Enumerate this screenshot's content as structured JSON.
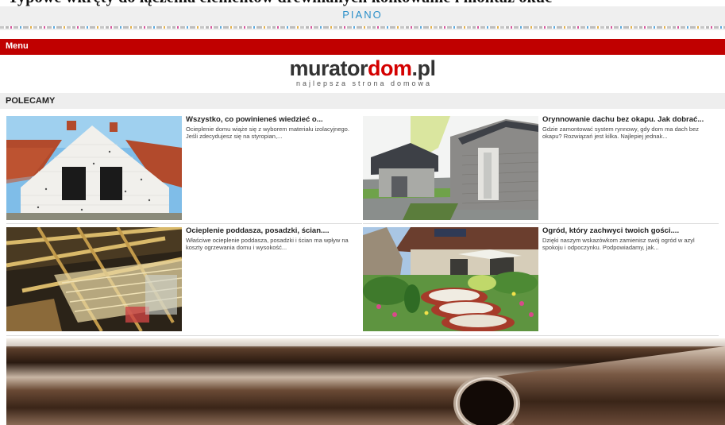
{
  "top_cut_text": "Typowe wkręty do łączenia elementów drewnianych kołkowanie i montaż okuć",
  "piano": {
    "label": "PIANO"
  },
  "menu": {
    "label": "Menu"
  },
  "logo": {
    "part1": "murator",
    "part2": "dom",
    "part3": ".pl",
    "tagline": "najlepsza strona domowa"
  },
  "section": {
    "title": "POLECAMY"
  },
  "cards": [
    {
      "title": "Wszystko, co powinieneś wiedzieć o...",
      "description": "Ocieplenie domu wiąże się z wyborem materiału izolacyjnego. Jeśli zdecydujesz się na styropian,..."
    },
    {
      "title": "Orynnowanie dachu bez okapu. Jak dobrać...",
      "description": "Gdzie zamontować system rynnowy, gdy dom ma dach bez okapu? Rozwiązań jest kilka. Najlepiej jednak..."
    },
    {
      "title": "Ocieplenie poddasza, posadzki, ścian....",
      "description": "Właściwe ocieplenie poddasza, posadzki i ścian ma wpływ na koszty ogrzewania domu i wysokość..."
    },
    {
      "title": "Ogród, który zachwyci twoich gości....",
      "description": "Dzięki naszym wskazówkom zamienisz swój ogród w azyl spokoju i odpoczynku. Podpowiadamy, jak..."
    }
  ],
  "colors": {
    "menu_bg": "#c00000",
    "logo_accent": "#d40000",
    "piano_text": "#2a8fc9"
  }
}
